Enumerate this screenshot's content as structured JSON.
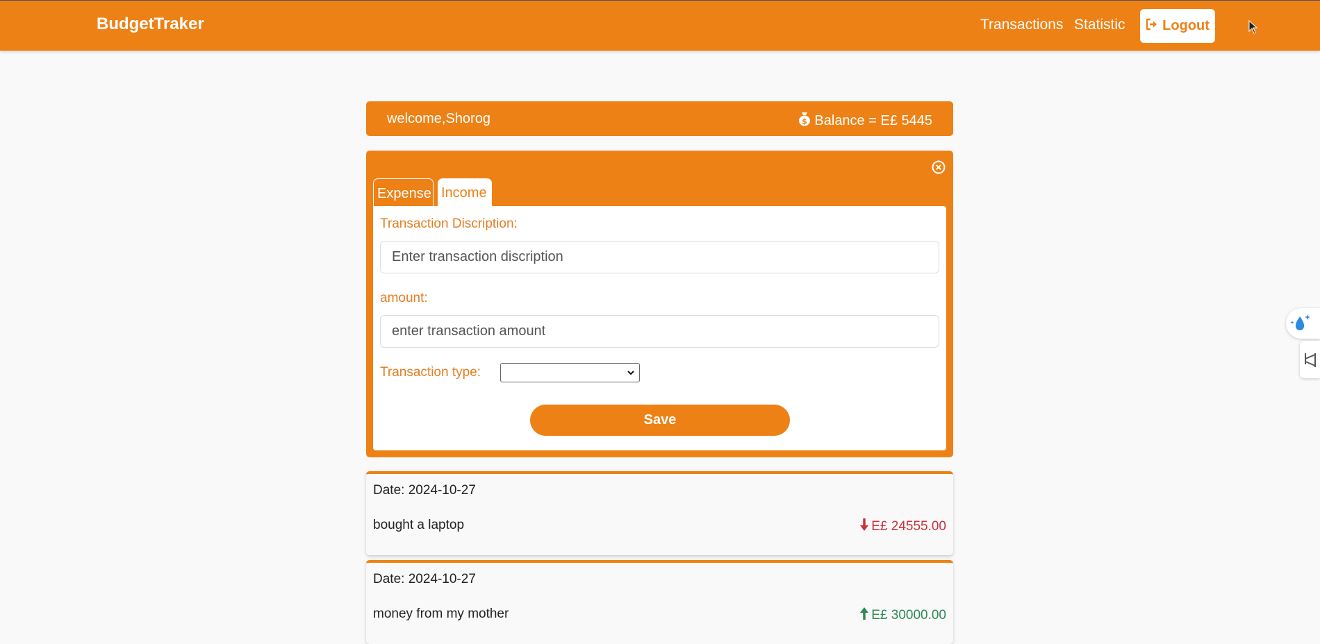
{
  "navbar": {
    "brand": "BudgetTraker",
    "links": [
      "Transactions",
      "Statistic"
    ],
    "logout_label": "Logout",
    "logout_icon": "logout-icon"
  },
  "welcome": {
    "greeting": "welcome,Shorog",
    "balance": "Balance = E£ 5445",
    "balance_icon": "money-bag-icon"
  },
  "form": {
    "tabs": [
      "Expense",
      "Income"
    ],
    "active_tab": "Income",
    "description_label": "Transaction Discription:",
    "description_placeholder": "Enter transaction discription",
    "amount_label": "amount:",
    "amount_placeholder": "enter transaction amount",
    "type_label": "Transaction type:",
    "type_value": "",
    "save_label": "Save"
  },
  "transactions": [
    {
      "date": "Date: 2024-10-27",
      "description": "bought a laptop",
      "amount": "E£ 24555.00",
      "kind": "expense",
      "icon": "arrow-down-icon",
      "color": "#c9333c"
    },
    {
      "date": "Date: 2024-10-27",
      "description": "money from my mother",
      "amount": "E£ 30000.00",
      "kind": "income",
      "icon": "arrow-up-icon",
      "color": "#2d8a55"
    }
  ],
  "colors": {
    "accent": "#ee8115",
    "background": "#f9f9f9"
  }
}
